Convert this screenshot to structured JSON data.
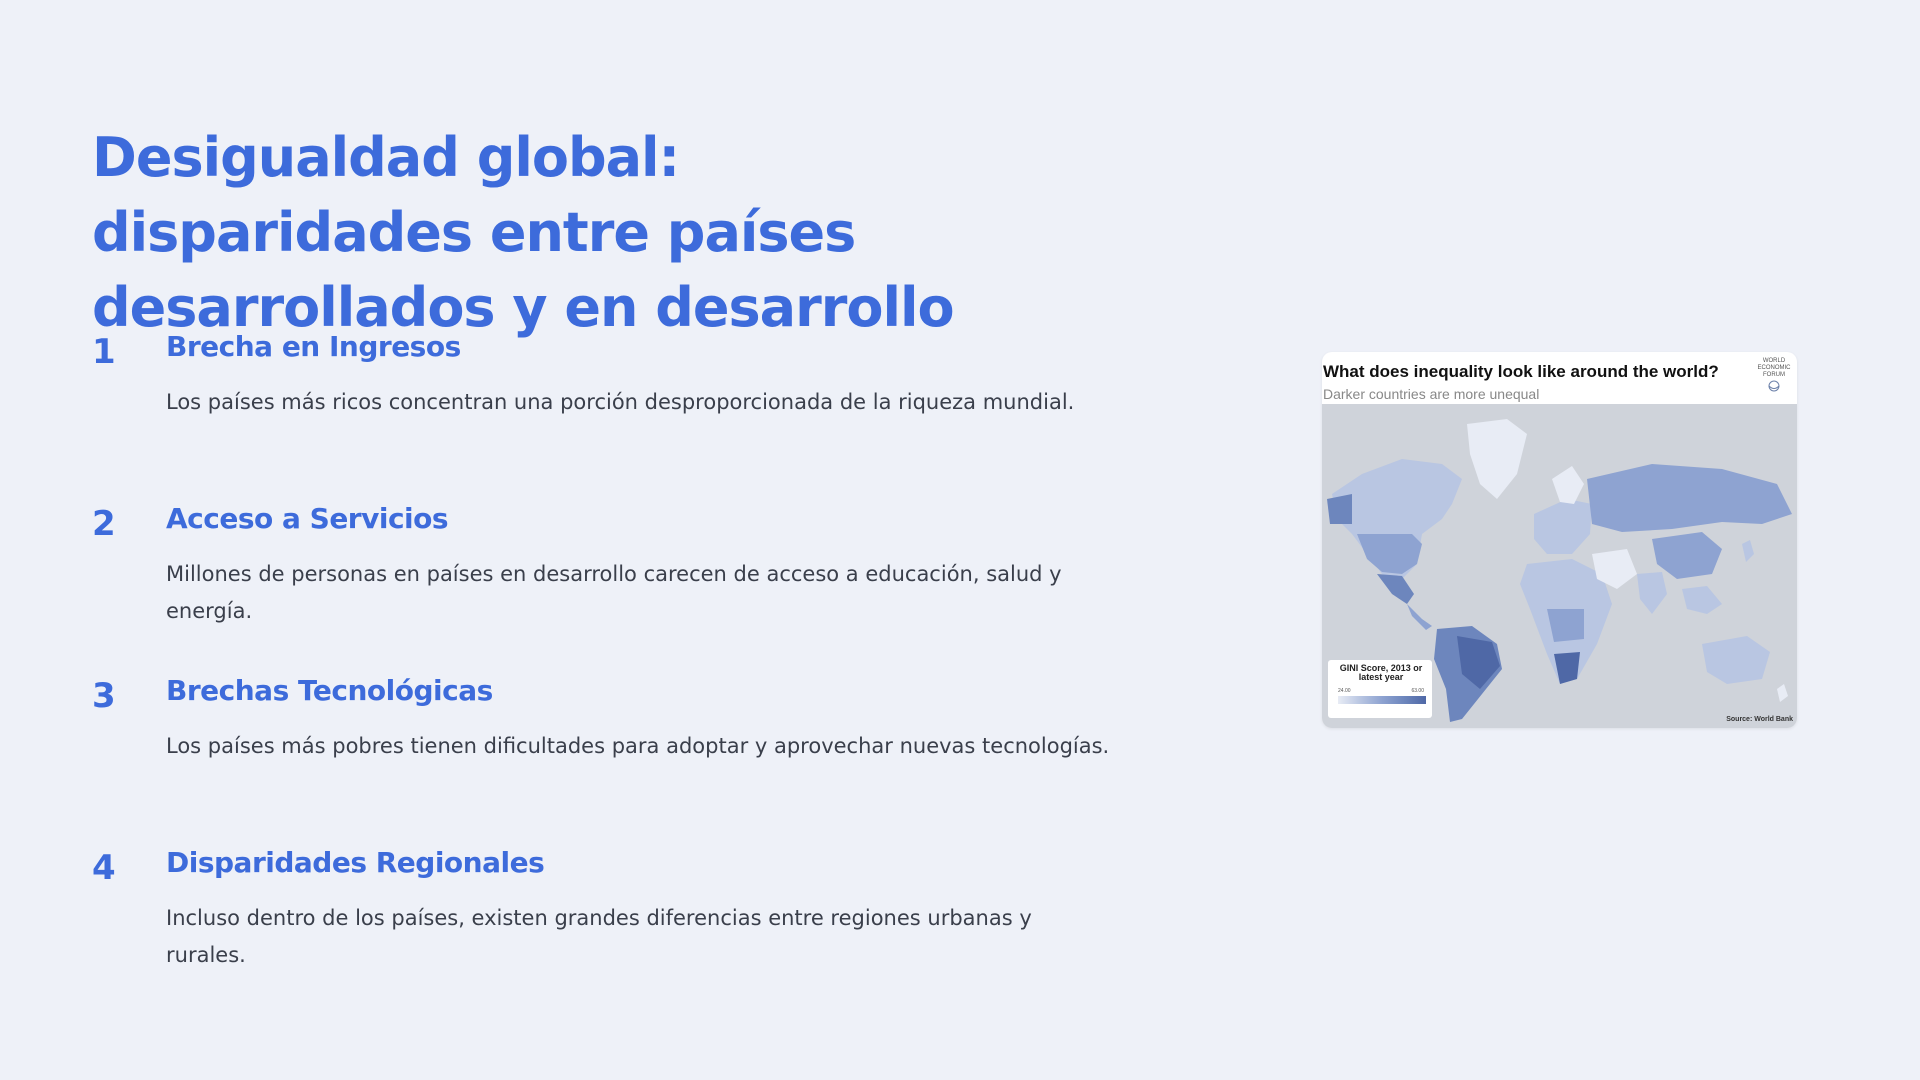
{
  "slide": {
    "title": "Desigualdad global: disparidades entre países desarrollados y en desarrollo",
    "items": [
      {
        "number": "1",
        "heading": "Brecha en Ingresos",
        "body": "Los países más ricos concentran una porción desproporcionada de la riqueza mundial."
      },
      {
        "number": "2",
        "heading": "Acceso a Servicios",
        "body": "Millones de personas en países en desarrollo carecen de acceso a educación, salud y energía."
      },
      {
        "number": "3",
        "heading": "Brechas Tecnológicas",
        "body": "Los países más pobres tienen dificultades para adoptar y aprovechar nuevas tecnologías."
      },
      {
        "number": "4",
        "heading": "Disparidades Regionales",
        "body": "Incluso dentro de los países, existen grandes diferencias entre regiones urbanas y rurales."
      }
    ]
  },
  "figure": {
    "title": "What does inequality look like around the world?",
    "subtitle": "Darker countries are more unequal",
    "logo_text": "WORLD ECONOMIC FORUM",
    "legend_title": "GINI Score, 2013 or latest year",
    "legend_min": "24.00",
    "legend_max": "63.00",
    "source": "Source: World Bank",
    "colors": {
      "ocean": "#cfd3da",
      "lightest": "#e8ecf5",
      "light": "#b9c6e2",
      "medium": "#8ea3d1",
      "dark": "#6d86bd",
      "darkest": "#4f68a6"
    }
  },
  "theme": {
    "accent": "#3d6bdb",
    "background": "#eef1f8",
    "body_text": "#3a3f4b"
  }
}
